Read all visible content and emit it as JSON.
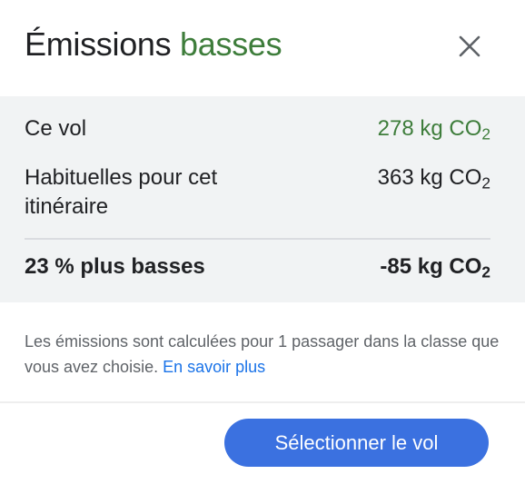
{
  "header": {
    "title_main": "Émissions",
    "title_accent": "basses",
    "close_icon": "close-icon"
  },
  "comparison": {
    "this_flight_label": "Ce vol",
    "this_flight_value": "278 kg CO",
    "typical_label": "Habituelles pour cet itinéraire",
    "typical_value": "363 kg CO",
    "difference_label": "23 % plus basses",
    "difference_value": "-85 kg CO",
    "subscript": "2"
  },
  "note": {
    "text": "Les émissions sont calculées pour 1 passager dans la classe que vous avez choisie.",
    "link": "En savoir plus"
  },
  "footer": {
    "select_button": "Sélectionner le vol"
  },
  "colors": {
    "accent_green": "#3e7d3b",
    "button_blue": "#3b71e0",
    "link_blue": "#1a73e8",
    "panel_bg": "#f1f3f4"
  }
}
